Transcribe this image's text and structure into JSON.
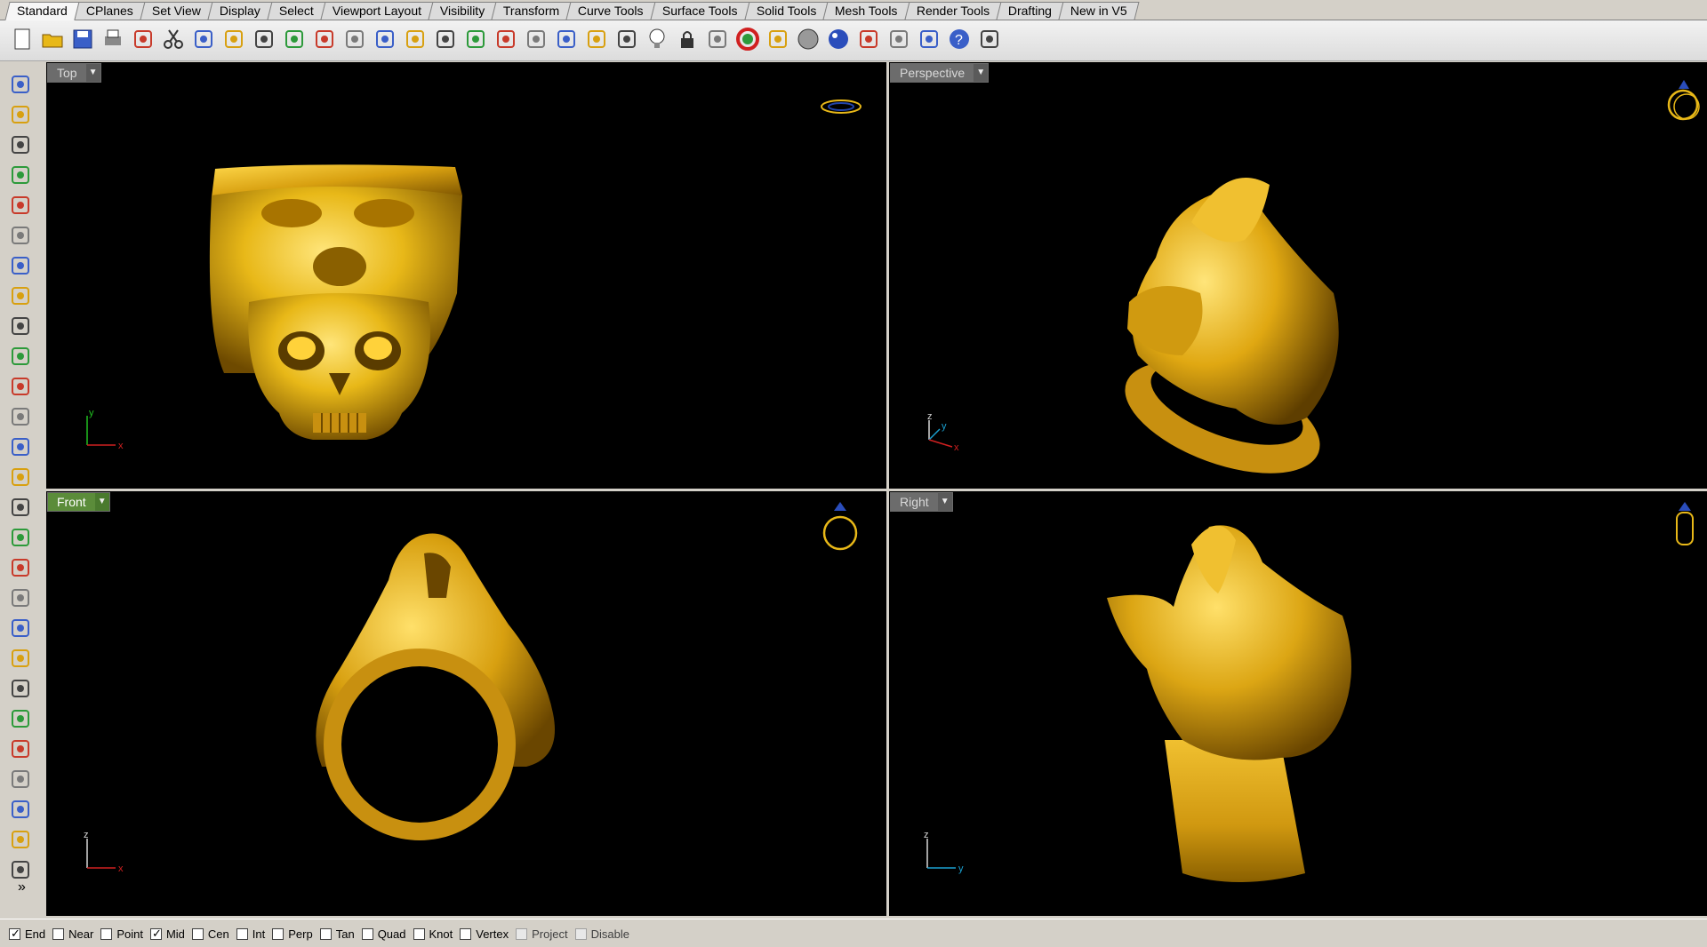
{
  "tabs": [
    "Standard",
    "CPlanes",
    "Set View",
    "Display",
    "Select",
    "Viewport Layout",
    "Visibility",
    "Transform",
    "Curve Tools",
    "Surface Tools",
    "Solid Tools",
    "Mesh Tools",
    "Render Tools",
    "Drafting",
    "New in V5"
  ],
  "active_tab": "Standard",
  "toolbar_icons": [
    "new-icon",
    "open-icon",
    "save-icon",
    "print-icon",
    "import-icon",
    "cut-icon",
    "copy-icon",
    "paste-icon",
    "undo-icon",
    "pan-icon",
    "rotate-view-icon",
    "zoom-icon",
    "zoom-window-icon",
    "zoom-extents-icon",
    "zoom-selected-icon",
    "undo-view-icon",
    "four-viewports-icon",
    "named-view-icon",
    "cplane-icon",
    "circle-icon",
    "object-snap-icon",
    "light-icon",
    "lock-icon",
    "layer-icon",
    "color-wheel-icon",
    "wireframe-icon",
    "shaded-icon",
    "rendered-icon",
    "render-icon",
    "options-icon",
    "dimension-icon",
    "help-icon",
    "command-help-icon"
  ],
  "left_tools": [
    "select-arrow-icon",
    "point-icon",
    "polyline-icon",
    "curve-icon",
    "circle-tool-icon",
    "ellipse-icon",
    "polygon-icon",
    "rectangle-icon",
    "arc-icon",
    "fillet-icon",
    "surface-icon",
    "extrude-icon",
    "box-icon",
    "boolean-icon",
    "cylinder-icon",
    "mesh-icon",
    "gear-icon",
    "transform-icon",
    "trim-icon",
    "extend-icon",
    "group-icon",
    "explode-icon",
    "curve-offset-icon",
    "blend-icon",
    "text-icon",
    "scale-icon",
    "array-icon"
  ],
  "more_glyph": "»",
  "viewports": {
    "top": {
      "label": "Top",
      "axis1": "y",
      "axis2": "x"
    },
    "perspective": {
      "label": "Perspective",
      "axis1": "z",
      "axis2": "y",
      "axis3": "x"
    },
    "front": {
      "label": "Front",
      "axis1": "z",
      "axis2": "x"
    },
    "right": {
      "label": "Right",
      "axis1": "z",
      "axis2": "y"
    }
  },
  "active_viewport": "Front",
  "colors": {
    "gold": "#e8b818",
    "gold_dark": "#7a5200",
    "gold_light": "#ffe066",
    "viewport_bg": "#000000",
    "active_label": "#5b8c3a",
    "axis_x": "#d02020",
    "axis_y": "#20c020",
    "axis_y_persp": "#1aa0d0"
  },
  "osnaps": [
    {
      "label": "End",
      "checked": true,
      "enabled": true
    },
    {
      "label": "Near",
      "checked": false,
      "enabled": true
    },
    {
      "label": "Point",
      "checked": false,
      "enabled": true
    },
    {
      "label": "Mid",
      "checked": true,
      "enabled": true
    },
    {
      "label": "Cen",
      "checked": false,
      "enabled": true
    },
    {
      "label": "Int",
      "checked": false,
      "enabled": true
    },
    {
      "label": "Perp",
      "checked": false,
      "enabled": true
    },
    {
      "label": "Tan",
      "checked": false,
      "enabled": true
    },
    {
      "label": "Quad",
      "checked": false,
      "enabled": true
    },
    {
      "label": "Knot",
      "checked": false,
      "enabled": true
    },
    {
      "label": "Vertex",
      "checked": false,
      "enabled": true
    },
    {
      "label": "Project",
      "checked": false,
      "enabled": false
    },
    {
      "label": "Disable",
      "checked": false,
      "enabled": false
    }
  ]
}
